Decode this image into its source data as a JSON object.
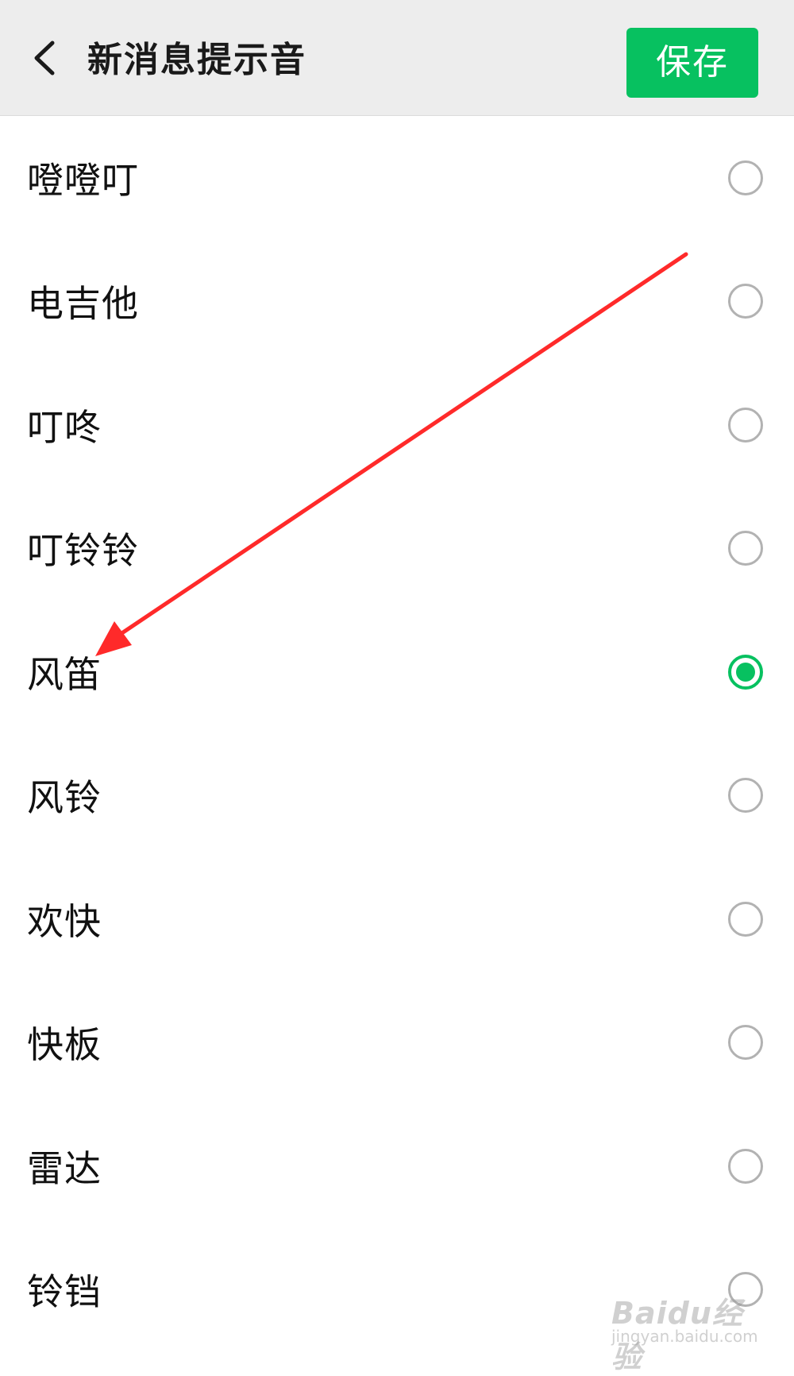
{
  "header": {
    "back_icon": "chevron-left-icon",
    "title": "新消息提示音",
    "save_label": "保存",
    "accent_color": "#07c160"
  },
  "sounds": {
    "selected_index": 4,
    "items": [
      {
        "label": "噔噔叮",
        "selected": false
      },
      {
        "label": "电吉他",
        "selected": false
      },
      {
        "label": "叮咚",
        "selected": false
      },
      {
        "label": "叮铃铃",
        "selected": false
      },
      {
        "label": "风笛",
        "selected": true
      },
      {
        "label": "风铃",
        "selected": false
      },
      {
        "label": "欢快",
        "selected": false
      },
      {
        "label": "快板",
        "selected": false
      },
      {
        "label": "雷达",
        "selected": false
      },
      {
        "label": "铃铛",
        "selected": false
      }
    ]
  },
  "annotation": {
    "arrow_color": "#ff2a2a",
    "arrow_icon": "red-arrow-annotation"
  },
  "watermark": {
    "main": "Baidu经验",
    "sub": "jingyan.baidu.com"
  }
}
